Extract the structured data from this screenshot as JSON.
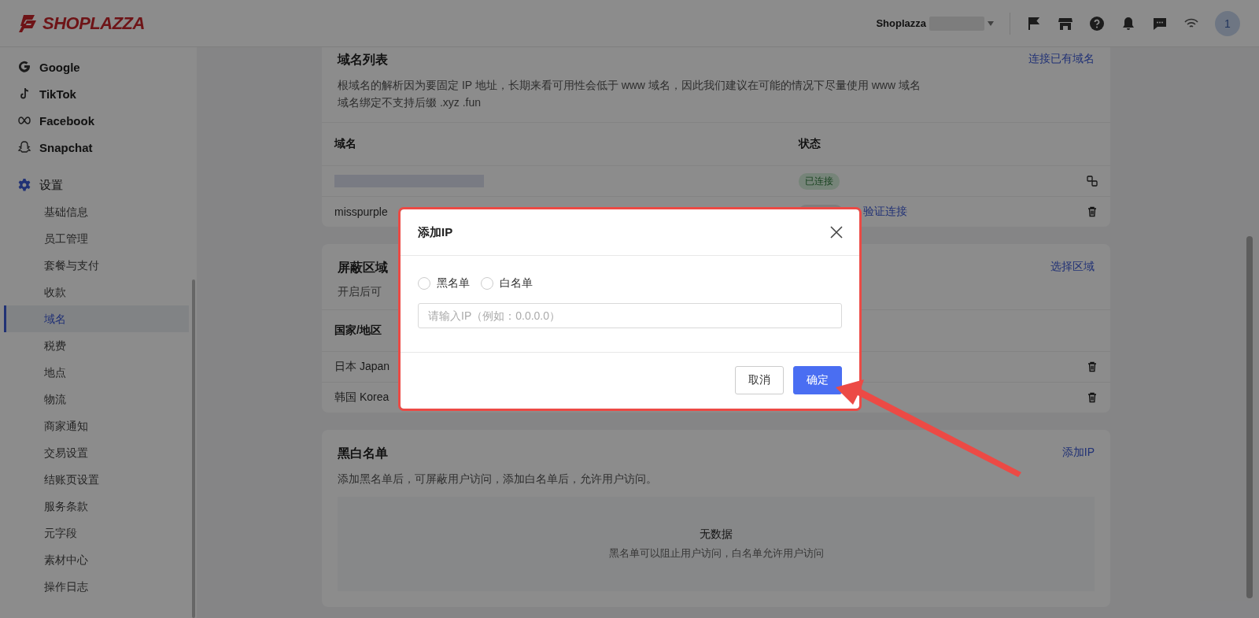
{
  "header": {
    "logo": "SHOPLAZZA",
    "store_name": "Shoplazza",
    "avatar": "1"
  },
  "sidebar": {
    "channels": [
      {
        "label": "Google",
        "kind": "google"
      },
      {
        "label": "TikTok",
        "kind": "tiktok"
      },
      {
        "label": "Facebook",
        "kind": "facebook"
      },
      {
        "label": "Snapchat",
        "kind": "snapchat"
      }
    ],
    "settings": {
      "label": "设置",
      "items": [
        {
          "label": "基础信息",
          "selected": false
        },
        {
          "label": "员工管理",
          "selected": false
        },
        {
          "label": "套餐与支付",
          "selected": false
        },
        {
          "label": "收款",
          "selected": false
        },
        {
          "label": "域名",
          "selected": true
        },
        {
          "label": "税费",
          "selected": false
        },
        {
          "label": "地点",
          "selected": false
        },
        {
          "label": "物流",
          "selected": false
        },
        {
          "label": "商家通知",
          "selected": false
        },
        {
          "label": "交易设置",
          "selected": false
        },
        {
          "label": "结账页设置",
          "selected": false
        },
        {
          "label": "服务条款",
          "selected": false
        },
        {
          "label": "元字段",
          "selected": false
        },
        {
          "label": "素材中心",
          "selected": false
        },
        {
          "label": "操作日志",
          "selected": false
        }
      ]
    }
  },
  "domain_card": {
    "title": "域名列表",
    "action": "连接已有域名",
    "description": [
      "根域名的解析因为要固定 IP 地址，长期来看可用性会低于 www 域名，因此我们建议在可能的情况下尽量使用 www 域名",
      "域名绑定不支持后缀 .xyz .fun"
    ],
    "columns": [
      "域名",
      "状态"
    ],
    "rows": [
      {
        "kind": "connected",
        "status": "已连接"
      },
      {
        "kind": "pending",
        "domain": "misspurple",
        "action": "验证连接"
      }
    ]
  },
  "block_card": {
    "title": "屏蔽区域",
    "action": "选择区域",
    "description": "开启后可",
    "columns": [
      "国家/地区"
    ],
    "rows": [
      "日本 Japan",
      "韩国 Korea"
    ]
  },
  "list_card": {
    "title": "黑白名单",
    "action": "添加IP",
    "description": "添加黑名单后，可屏蔽用户访问，添加白名单后，允许用户访问。",
    "empty_title": "无数据",
    "empty_hint": "黑名单可以阻止用户访问，白名单允许用户访问"
  },
  "modal": {
    "title": "添加IP",
    "options": [
      {
        "label": "黑名单",
        "selected": false
      },
      {
        "label": "白名单",
        "selected": false
      }
    ],
    "placeholder": "请输入IP（例如：0.0.0.0）",
    "cancel": "取消",
    "confirm": "确定"
  }
}
